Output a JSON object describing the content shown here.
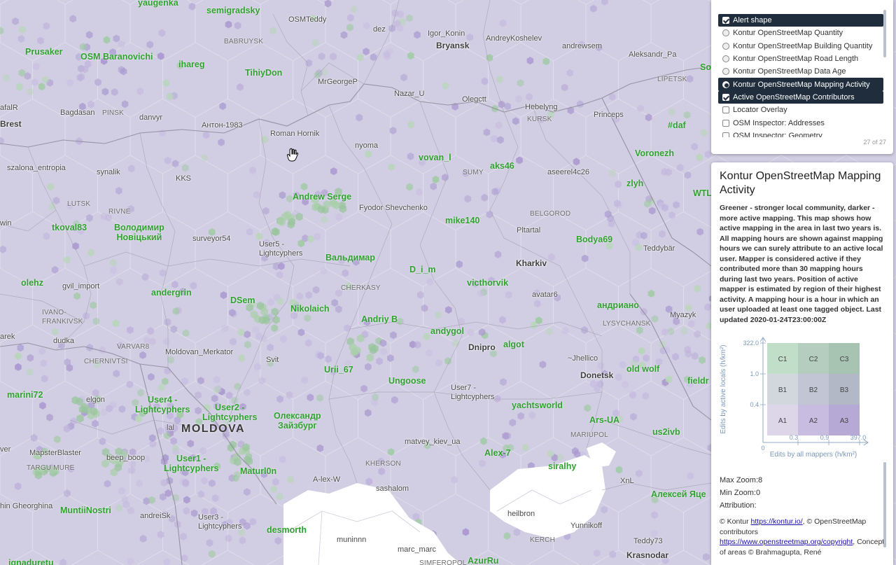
{
  "map": {
    "country_label": "MOLDOVA",
    "user_labels": [
      {
        "text": "yaugenka"
      },
      {
        "text": "semigradsky"
      },
      {
        "text": "Prusaker"
      },
      {
        "text": "OSM Baranovichi"
      },
      {
        "text": "ihareg"
      },
      {
        "text": "TihiyDon"
      },
      {
        "text": "So"
      },
      {
        "text": "#daf"
      },
      {
        "text": "Voronezh"
      },
      {
        "text": "vovan_l"
      },
      {
        "text": "aks46"
      },
      {
        "text": "zlyh"
      },
      {
        "text": "WTL"
      },
      {
        "text": "Andrew Serge"
      },
      {
        "text": "tkoval83"
      },
      {
        "text": "Володимир\nНовіцький"
      },
      {
        "text": "mike140"
      },
      {
        "text": "Bodya69"
      },
      {
        "text": "Вальдимар"
      },
      {
        "text": "D_i_m"
      },
      {
        "text": "olehz"
      },
      {
        "text": "andergrin"
      },
      {
        "text": "victhorvik"
      },
      {
        "text": "DSem"
      },
      {
        "text": "Nikolaich"
      },
      {
        "text": "андриано"
      },
      {
        "text": "Andriy B"
      },
      {
        "text": "andygol"
      },
      {
        "text": "algot"
      },
      {
        "text": "old wolf"
      },
      {
        "text": "Urii_67"
      },
      {
        "text": "fieldr"
      },
      {
        "text": "Ungoose"
      },
      {
        "text": "marini72"
      },
      {
        "text": "User4 -\nLightcyphers"
      },
      {
        "text": "User2 -\nLightcyphers"
      },
      {
        "text": "Олександр\nЗайзбург"
      },
      {
        "text": "yachtsworld"
      },
      {
        "text": "Ars-UA"
      },
      {
        "text": "us2ivb"
      },
      {
        "text": "User1 -\nLightcyphers"
      },
      {
        "text": "Alex-7"
      },
      {
        "text": "Maturl0n"
      },
      {
        "text": "siralhy"
      },
      {
        "text": "Алексей Яце"
      },
      {
        "text": "MuntiiNostri"
      },
      {
        "text": "desmorth"
      },
      {
        "text": "AzurRu"
      },
      {
        "text": "ignaduretu"
      }
    ],
    "place_labels": [
      {
        "text": "OSMTeddy"
      },
      {
        "text": "dez"
      },
      {
        "text": "Igor_Konin"
      },
      {
        "text": "AndreyKoshelev"
      },
      {
        "text": "andrewsem"
      },
      {
        "text": "Aleksandr_Pa"
      },
      {
        "text": "MrGeorgeP"
      },
      {
        "text": "Nazar_U"
      },
      {
        "text": "Olegctt"
      },
      {
        "text": "Bagdasan"
      },
      {
        "text": "danvyr"
      },
      {
        "text": "Нebelyng"
      },
      {
        "text": "Princeps"
      },
      {
        "text": "Антон-1983"
      },
      {
        "text": "Roman Hornik"
      },
      {
        "text": "nyoma"
      },
      {
        "text": "szalona_entropia"
      },
      {
        "text": "synalik"
      },
      {
        "text": "KKS"
      },
      {
        "text": "aseerel4c26"
      },
      {
        "text": "Fyodor Shevchenko"
      },
      {
        "text": "surveyor54"
      },
      {
        "text": "User5 -\nLightcyphers"
      },
      {
        "text": "Pltartal"
      },
      {
        "text": "Teddybär"
      },
      {
        "text": "gvil_import"
      },
      {
        "text": "avatar6"
      },
      {
        "text": "Myazyk"
      },
      {
        "text": "dudka"
      },
      {
        "text": "Moldovan_Merkator"
      },
      {
        "text": "Svit"
      },
      {
        "text": "~Jhellico"
      },
      {
        "text": "elgon"
      },
      {
        "text": "User7 -\nLightcyphers"
      },
      {
        "text": "MapsterBlaster"
      },
      {
        "text": "beep_boop"
      },
      {
        "text": "matvey_kiev_ua"
      },
      {
        "text": "A-lex-W"
      },
      {
        "text": "sashalom"
      },
      {
        "text": "XnL"
      },
      {
        "text": "hin Gheorghina"
      },
      {
        "text": "andreiSk"
      },
      {
        "text": "User3 -\nLightcyphers"
      },
      {
        "text": "heilbron"
      },
      {
        "text": "Yunnikoff"
      },
      {
        "text": "muninnn"
      },
      {
        "text": "marc_marc"
      },
      {
        "text": "Teddy73"
      },
      {
        "text": "afalR"
      },
      {
        "text": "win"
      },
      {
        "text": "arek"
      },
      {
        "text": "lal"
      },
      {
        "text": "ver"
      }
    ],
    "city_labels": [
      {
        "text": "Bryansk"
      },
      {
        "text": "Brest"
      },
      {
        "text": "Kharkiv"
      },
      {
        "text": "Dnipro"
      },
      {
        "text": "Donetsk"
      },
      {
        "text": "Krasnodar"
      }
    ],
    "region_labels": [
      {
        "text": "BABRUYSK"
      },
      {
        "text": "PINSK"
      },
      {
        "text": "LIPETSK"
      },
      {
        "text": "KURSK"
      },
      {
        "text": "SUMY"
      },
      {
        "text": "LUTSK"
      },
      {
        "text": "RIVNE"
      },
      {
        "text": "BELGOROD"
      },
      {
        "text": "CHERKASY"
      },
      {
        "text": "IVANO-\nFRANKIVSK"
      },
      {
        "text": "LYSYCHANSK"
      },
      {
        "text": "VARVAR8"
      },
      {
        "text": "CHERNIVTSI"
      },
      {
        "text": "MARIUPOL"
      },
      {
        "text": "TARGU MURE"
      },
      {
        "text": "KHERSON"
      },
      {
        "text": "KERCH"
      },
      {
        "text": "SIMFEROPOL"
      }
    ]
  },
  "layer_switcher": {
    "items": [
      {
        "label": "Alert shape",
        "type": "checkbox",
        "checked": true,
        "active": true
      },
      {
        "label": "Kontur OpenStreetMap Quantity",
        "type": "radio",
        "checked": false,
        "active": false
      },
      {
        "label": "Kontur OpenStreetMap Building Quantity",
        "type": "radio",
        "checked": false,
        "active": false
      },
      {
        "label": "Kontur OpenStreetMap Road Length",
        "type": "radio",
        "checked": false,
        "active": false
      },
      {
        "label": "Kontur OpenStreetMap Data Age",
        "type": "radio",
        "checked": false,
        "active": false
      },
      {
        "label": "Kontur OpenStreetMap Mapping Activity",
        "type": "radio",
        "checked": true,
        "active": true
      },
      {
        "label": "Active OpenStreetMap Contributors",
        "type": "checkbox",
        "checked": true,
        "active": true
      },
      {
        "label": "Locator Overlay",
        "type": "checkbox",
        "checked": false,
        "active": false
      },
      {
        "label": "OSM Inspector: Addresses",
        "type": "checkbox",
        "checked": false,
        "active": false
      },
      {
        "label": "OSM Inspector: Geometry",
        "type": "checkbox",
        "checked": false,
        "active": false
      }
    ],
    "counter": "27 of 27"
  },
  "legend": {
    "title": "Kontur OpenStreetMap Mapping Activity",
    "description": "Greener - stronger local community, darker - more active mapping. This map shows how active mapping in the area in last two years is. All mapping hours are shown against mapping hours we can surely attribute to an active local user. Mapper is considered active if they contributed more than 30 mapping hours during last two years. Position of active mapper is estimated by region of their highest activity. A mapping hour is a hour in which an user uploaded at least one tagged object. Last updated 2020-01-24T23:00:00Z",
    "bivariate": {
      "y_label": "Edits by active locals (h/km²)",
      "x_label": "Edits by all mappers (h/km²)",
      "y_ticks": [
        "322.0",
        "1.0",
        "0.4"
      ],
      "x_ticks": [
        "0",
        "0.3",
        "0.9",
        "397.0"
      ],
      "cells": [
        {
          "label": "C1",
          "color": "#c1dfc8"
        },
        {
          "label": "C2",
          "color": "#b5cdbf"
        },
        {
          "label": "C3",
          "color": "#a7c3b2"
        },
        {
          "label": "B1",
          "color": "#d1d7dc"
        },
        {
          "label": "B2",
          "color": "#c2c5d3"
        },
        {
          "label": "B3",
          "color": "#b3b8c6"
        },
        {
          "label": "A1",
          "color": "#dcd6e8"
        },
        {
          "label": "A2",
          "color": "#c8bde0"
        },
        {
          "label": "A3",
          "color": "#b7a9d6"
        }
      ]
    },
    "max_zoom": "Max Zoom:8",
    "min_zoom": "Min Zoom:0",
    "attribution_label": "Attribution:",
    "attribution": {
      "prefix": "© Kontur ",
      "kontur_link": "https://kontur.io/",
      "middle": ", © OpenStreetMap contributors ",
      "osm_link": "https://www.openstreetmap.org/copyright",
      "suffix": ", Concept of areas © Brahmagupta, René"
    }
  }
}
